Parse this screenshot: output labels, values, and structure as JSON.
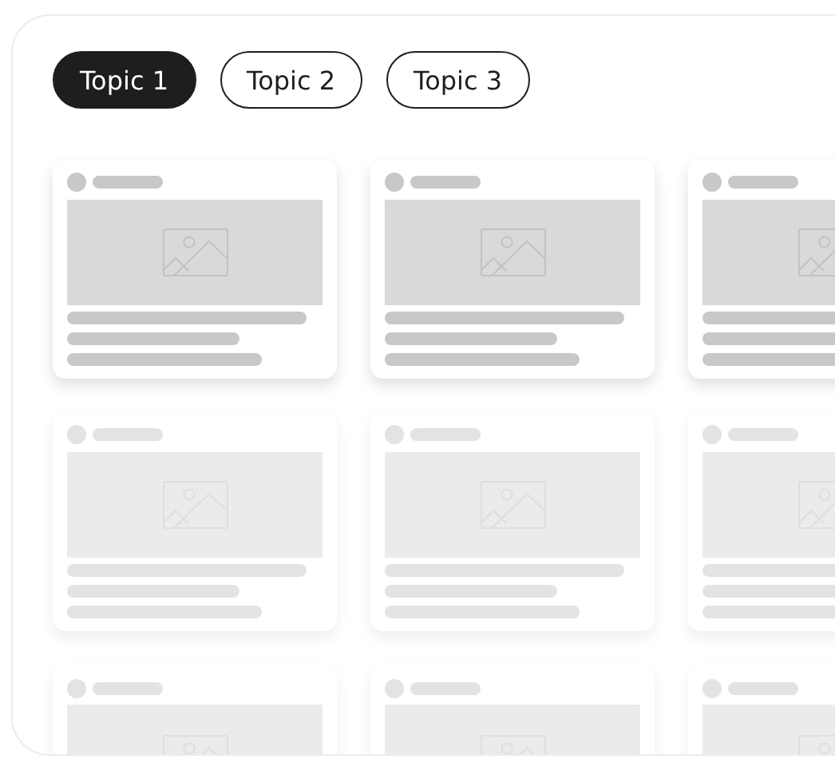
{
  "tabs": [
    {
      "label": "Topic 1",
      "selected": true
    },
    {
      "label": "Topic 2",
      "selected": false
    },
    {
      "label": "Topic 3",
      "selected": false
    }
  ],
  "card_rows": [
    {
      "faded": false,
      "cards": [
        {
          "kind": "placeholder"
        },
        {
          "kind": "placeholder"
        },
        {
          "kind": "placeholder"
        }
      ]
    },
    {
      "faded": true,
      "cards": [
        {
          "kind": "placeholder"
        },
        {
          "kind": "placeholder"
        },
        {
          "kind": "placeholder"
        }
      ]
    },
    {
      "faded": true,
      "cards": [
        {
          "kind": "cut"
        },
        {
          "kind": "cut"
        },
        {
          "kind": "cut"
        }
      ]
    }
  ]
}
